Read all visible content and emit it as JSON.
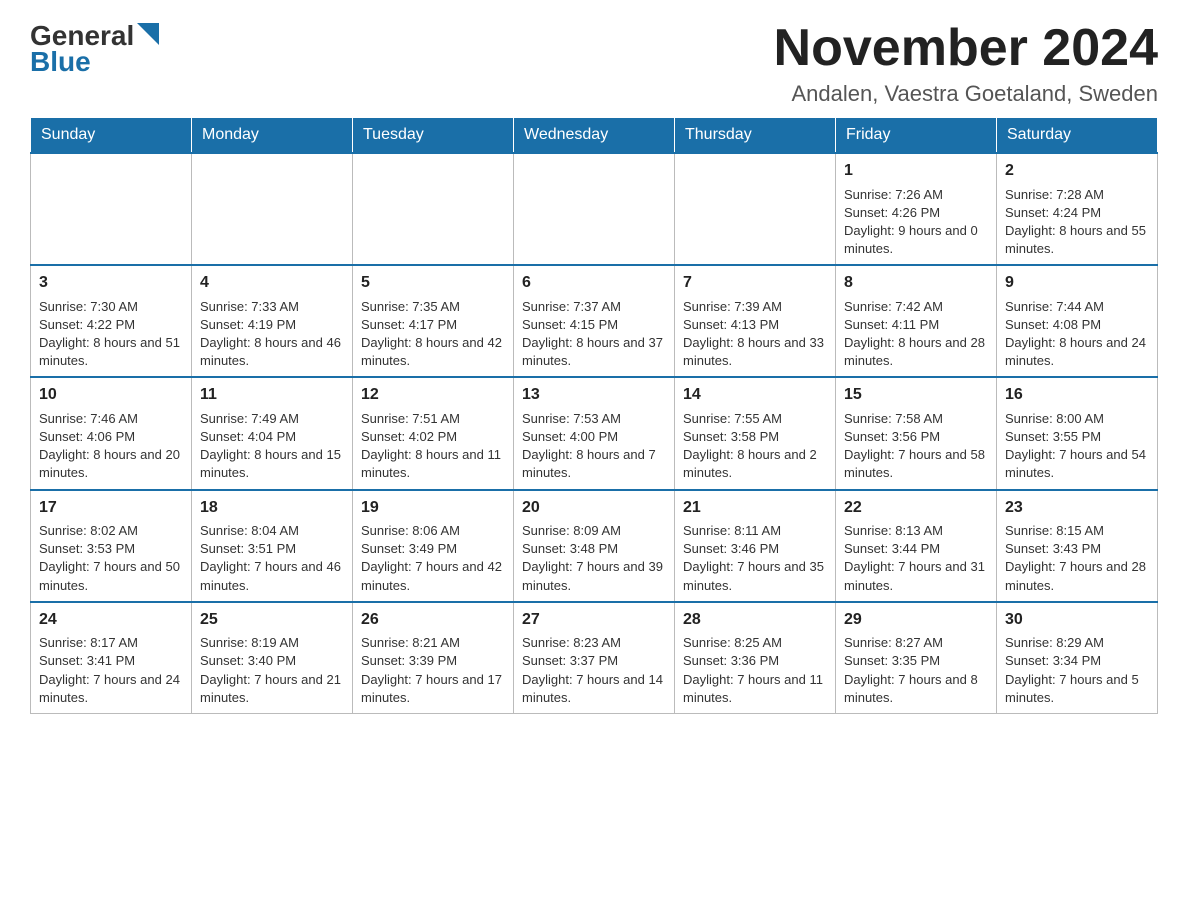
{
  "header": {
    "logo_general": "General",
    "logo_blue": "Blue",
    "month_title": "November 2024",
    "location": "Andalen, Vaestra Goetaland, Sweden"
  },
  "weekdays": [
    "Sunday",
    "Monday",
    "Tuesday",
    "Wednesday",
    "Thursday",
    "Friday",
    "Saturday"
  ],
  "weeks": [
    [
      {
        "day": "",
        "info": ""
      },
      {
        "day": "",
        "info": ""
      },
      {
        "day": "",
        "info": ""
      },
      {
        "day": "",
        "info": ""
      },
      {
        "day": "",
        "info": ""
      },
      {
        "day": "1",
        "info": "Sunrise: 7:26 AM\nSunset: 4:26 PM\nDaylight: 9 hours and 0 minutes."
      },
      {
        "day": "2",
        "info": "Sunrise: 7:28 AM\nSunset: 4:24 PM\nDaylight: 8 hours and 55 minutes."
      }
    ],
    [
      {
        "day": "3",
        "info": "Sunrise: 7:30 AM\nSunset: 4:22 PM\nDaylight: 8 hours and 51 minutes."
      },
      {
        "day": "4",
        "info": "Sunrise: 7:33 AM\nSunset: 4:19 PM\nDaylight: 8 hours and 46 minutes."
      },
      {
        "day": "5",
        "info": "Sunrise: 7:35 AM\nSunset: 4:17 PM\nDaylight: 8 hours and 42 minutes."
      },
      {
        "day": "6",
        "info": "Sunrise: 7:37 AM\nSunset: 4:15 PM\nDaylight: 8 hours and 37 minutes."
      },
      {
        "day": "7",
        "info": "Sunrise: 7:39 AM\nSunset: 4:13 PM\nDaylight: 8 hours and 33 minutes."
      },
      {
        "day": "8",
        "info": "Sunrise: 7:42 AM\nSunset: 4:11 PM\nDaylight: 8 hours and 28 minutes."
      },
      {
        "day": "9",
        "info": "Sunrise: 7:44 AM\nSunset: 4:08 PM\nDaylight: 8 hours and 24 minutes."
      }
    ],
    [
      {
        "day": "10",
        "info": "Sunrise: 7:46 AM\nSunset: 4:06 PM\nDaylight: 8 hours and 20 minutes."
      },
      {
        "day": "11",
        "info": "Sunrise: 7:49 AM\nSunset: 4:04 PM\nDaylight: 8 hours and 15 minutes."
      },
      {
        "day": "12",
        "info": "Sunrise: 7:51 AM\nSunset: 4:02 PM\nDaylight: 8 hours and 11 minutes."
      },
      {
        "day": "13",
        "info": "Sunrise: 7:53 AM\nSunset: 4:00 PM\nDaylight: 8 hours and 7 minutes."
      },
      {
        "day": "14",
        "info": "Sunrise: 7:55 AM\nSunset: 3:58 PM\nDaylight: 8 hours and 2 minutes."
      },
      {
        "day": "15",
        "info": "Sunrise: 7:58 AM\nSunset: 3:56 PM\nDaylight: 7 hours and 58 minutes."
      },
      {
        "day": "16",
        "info": "Sunrise: 8:00 AM\nSunset: 3:55 PM\nDaylight: 7 hours and 54 minutes."
      }
    ],
    [
      {
        "day": "17",
        "info": "Sunrise: 8:02 AM\nSunset: 3:53 PM\nDaylight: 7 hours and 50 minutes."
      },
      {
        "day": "18",
        "info": "Sunrise: 8:04 AM\nSunset: 3:51 PM\nDaylight: 7 hours and 46 minutes."
      },
      {
        "day": "19",
        "info": "Sunrise: 8:06 AM\nSunset: 3:49 PM\nDaylight: 7 hours and 42 minutes."
      },
      {
        "day": "20",
        "info": "Sunrise: 8:09 AM\nSunset: 3:48 PM\nDaylight: 7 hours and 39 minutes."
      },
      {
        "day": "21",
        "info": "Sunrise: 8:11 AM\nSunset: 3:46 PM\nDaylight: 7 hours and 35 minutes."
      },
      {
        "day": "22",
        "info": "Sunrise: 8:13 AM\nSunset: 3:44 PM\nDaylight: 7 hours and 31 minutes."
      },
      {
        "day": "23",
        "info": "Sunrise: 8:15 AM\nSunset: 3:43 PM\nDaylight: 7 hours and 28 minutes."
      }
    ],
    [
      {
        "day": "24",
        "info": "Sunrise: 8:17 AM\nSunset: 3:41 PM\nDaylight: 7 hours and 24 minutes."
      },
      {
        "day": "25",
        "info": "Sunrise: 8:19 AM\nSunset: 3:40 PM\nDaylight: 7 hours and 21 minutes."
      },
      {
        "day": "26",
        "info": "Sunrise: 8:21 AM\nSunset: 3:39 PM\nDaylight: 7 hours and 17 minutes."
      },
      {
        "day": "27",
        "info": "Sunrise: 8:23 AM\nSunset: 3:37 PM\nDaylight: 7 hours and 14 minutes."
      },
      {
        "day": "28",
        "info": "Sunrise: 8:25 AM\nSunset: 3:36 PM\nDaylight: 7 hours and 11 minutes."
      },
      {
        "day": "29",
        "info": "Sunrise: 8:27 AM\nSunset: 3:35 PM\nDaylight: 7 hours and 8 minutes."
      },
      {
        "day": "30",
        "info": "Sunrise: 8:29 AM\nSunset: 3:34 PM\nDaylight: 7 hours and 5 minutes."
      }
    ]
  ]
}
